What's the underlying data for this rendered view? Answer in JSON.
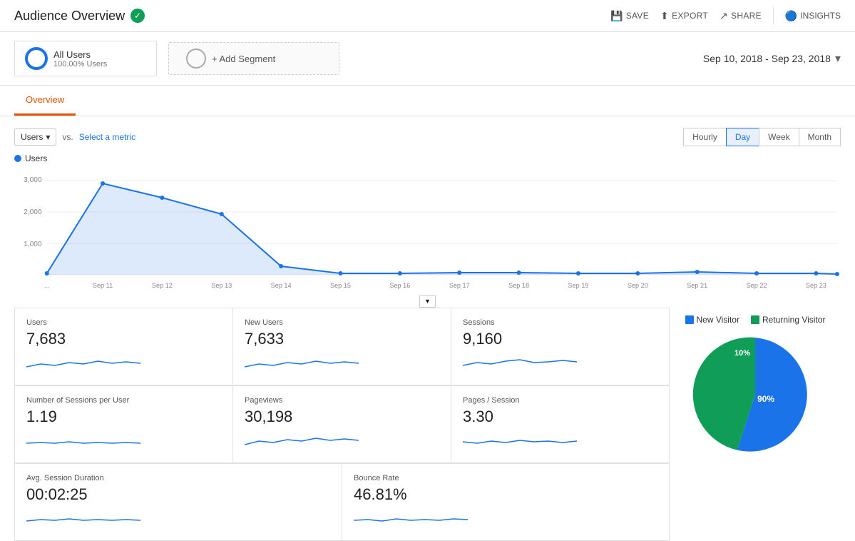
{
  "header": {
    "title": "Audience Overview",
    "verified": true,
    "actions": {
      "save": "SAVE",
      "export": "EXPORT",
      "share": "SHARE",
      "insights": "INSIGHTS"
    }
  },
  "segments": {
    "segment1": {
      "name": "All Users",
      "sub": "100.00% Users"
    },
    "add": "+ Add Segment"
  },
  "dateRange": "Sep 10, 2018 - Sep 23, 2018",
  "tabs": [
    "Overview"
  ],
  "chart": {
    "metric_label": "Users",
    "vs_label": "vs.",
    "select_metric": "Select a metric",
    "time_buttons": [
      "Hourly",
      "Day",
      "Week",
      "Month"
    ],
    "active_time": "Day",
    "legend": "Users",
    "y_labels": [
      "3,000",
      "2,000",
      "1,000"
    ],
    "x_labels": [
      "...",
      "Sep 11",
      "Sep 12",
      "Sep 13",
      "Sep 14",
      "Sep 15",
      "Sep 16",
      "Sep 17",
      "Sep 18",
      "Sep 19",
      "Sep 20",
      "Sep 21",
      "Sep 22",
      "Sep 23"
    ]
  },
  "stats": [
    {
      "label": "Users",
      "value": "7,683"
    },
    {
      "label": "New Users",
      "value": "7,633"
    },
    {
      "label": "Sessions",
      "value": "9,160"
    },
    {
      "label": "Number of Sessions per User",
      "value": "1.19"
    },
    {
      "label": "Pageviews",
      "value": "30,198"
    },
    {
      "label": "Pages / Session",
      "value": "3.30"
    },
    {
      "label": "Avg. Session Duration",
      "value": "00:02:25"
    },
    {
      "label": "Bounce Rate",
      "value": "46.81%"
    }
  ],
  "pie": {
    "new_visitor_label": "New Visitor",
    "returning_visitor_label": "Returning Visitor",
    "new_pct": 90,
    "returning_pct": 10,
    "new_label": "90%",
    "returning_label": "10%",
    "new_color": "#1a73e8",
    "returning_color": "#0f9d58"
  },
  "colors": {
    "accent_blue": "#1a73e8",
    "chart_fill": "rgba(26, 115, 232, 0.15)",
    "chart_line": "#1a73e8"
  }
}
